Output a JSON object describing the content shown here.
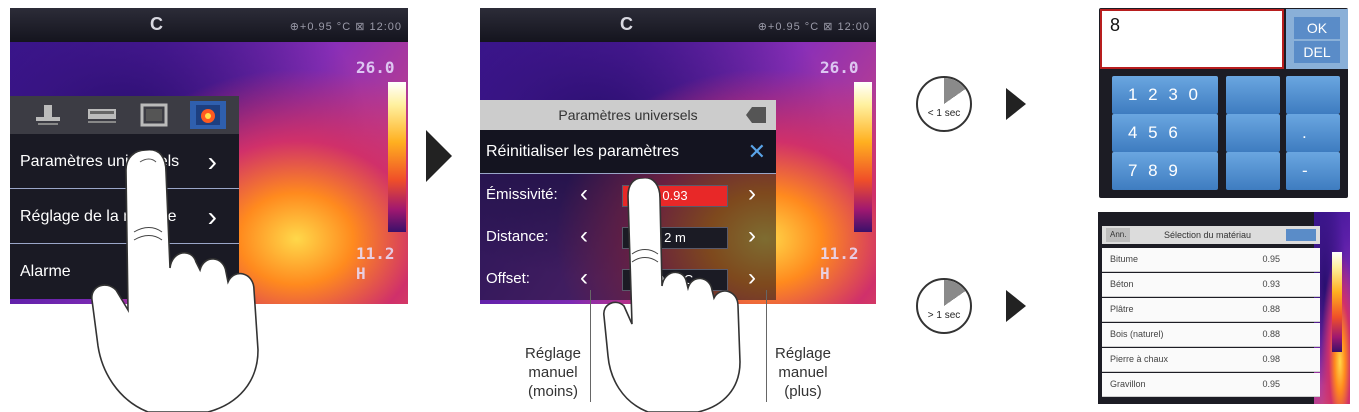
{
  "screen1": {
    "topbar": {
      "status": "⊕+0.95 °C ⊠ 12:00"
    },
    "scale_top": "26.0",
    "scale_bottom": "11.2",
    "scale_bottom2": "H",
    "icons": [
      "mode-icon",
      "layers-icon",
      "frame-icon",
      "thermal-icon"
    ],
    "menu": [
      {
        "label": "Paramètres universels"
      },
      {
        "label": "Réglage de la mesure"
      },
      {
        "label": "Alarme"
      }
    ]
  },
  "screen2": {
    "topbar": {
      "status": "⊕+0.95 °C ⊠ 12:00"
    },
    "scale_top": "26.0",
    "scale_bottom": "11.2",
    "scale_bottom2": "H",
    "title": "Paramètres universels",
    "reset_label": "Réinitialiser les paramètres",
    "params": [
      {
        "label": "Émissivité:",
        "value": "0.93"
      },
      {
        "label": "Distance:",
        "value": "2 m"
      },
      {
        "label": "Offset:",
        "value": "0.0 °C"
      }
    ],
    "callout_left": [
      "Réglage",
      "manuel",
      "(moins)"
    ],
    "callout_right": [
      "Réglage",
      "manuel",
      "(plus)"
    ]
  },
  "timers": [
    {
      "label": "< 1 sec"
    },
    {
      "label": "> 1 sec"
    }
  ],
  "keypad": {
    "input_value": "8",
    "ok_label": "OK",
    "del_label": "DEL",
    "rows": [
      [
        "1 2 3 0",
        "",
        ""
      ],
      [
        "4 5 6",
        "",
        "."
      ],
      [
        "7 8 9",
        "",
        "-"
      ]
    ]
  },
  "materials": {
    "cancel_label": "Ann.",
    "title": "Sélection du matériau",
    "items": [
      {
        "name": "Bitume",
        "value": "0.95"
      },
      {
        "name": "Béton",
        "value": "0.93"
      },
      {
        "name": "Plâtre",
        "value": "0.88"
      },
      {
        "name": "Bois (naturel)",
        "value": "0.88"
      },
      {
        "name": "Pierre à chaux",
        "value": "0.98"
      },
      {
        "name": "Gravillon",
        "value": "0.95"
      }
    ]
  },
  "colors": {
    "accent_blue": "#5a8cc8",
    "active_red": "#e82828",
    "menu_bg": "#1a1a24"
  }
}
